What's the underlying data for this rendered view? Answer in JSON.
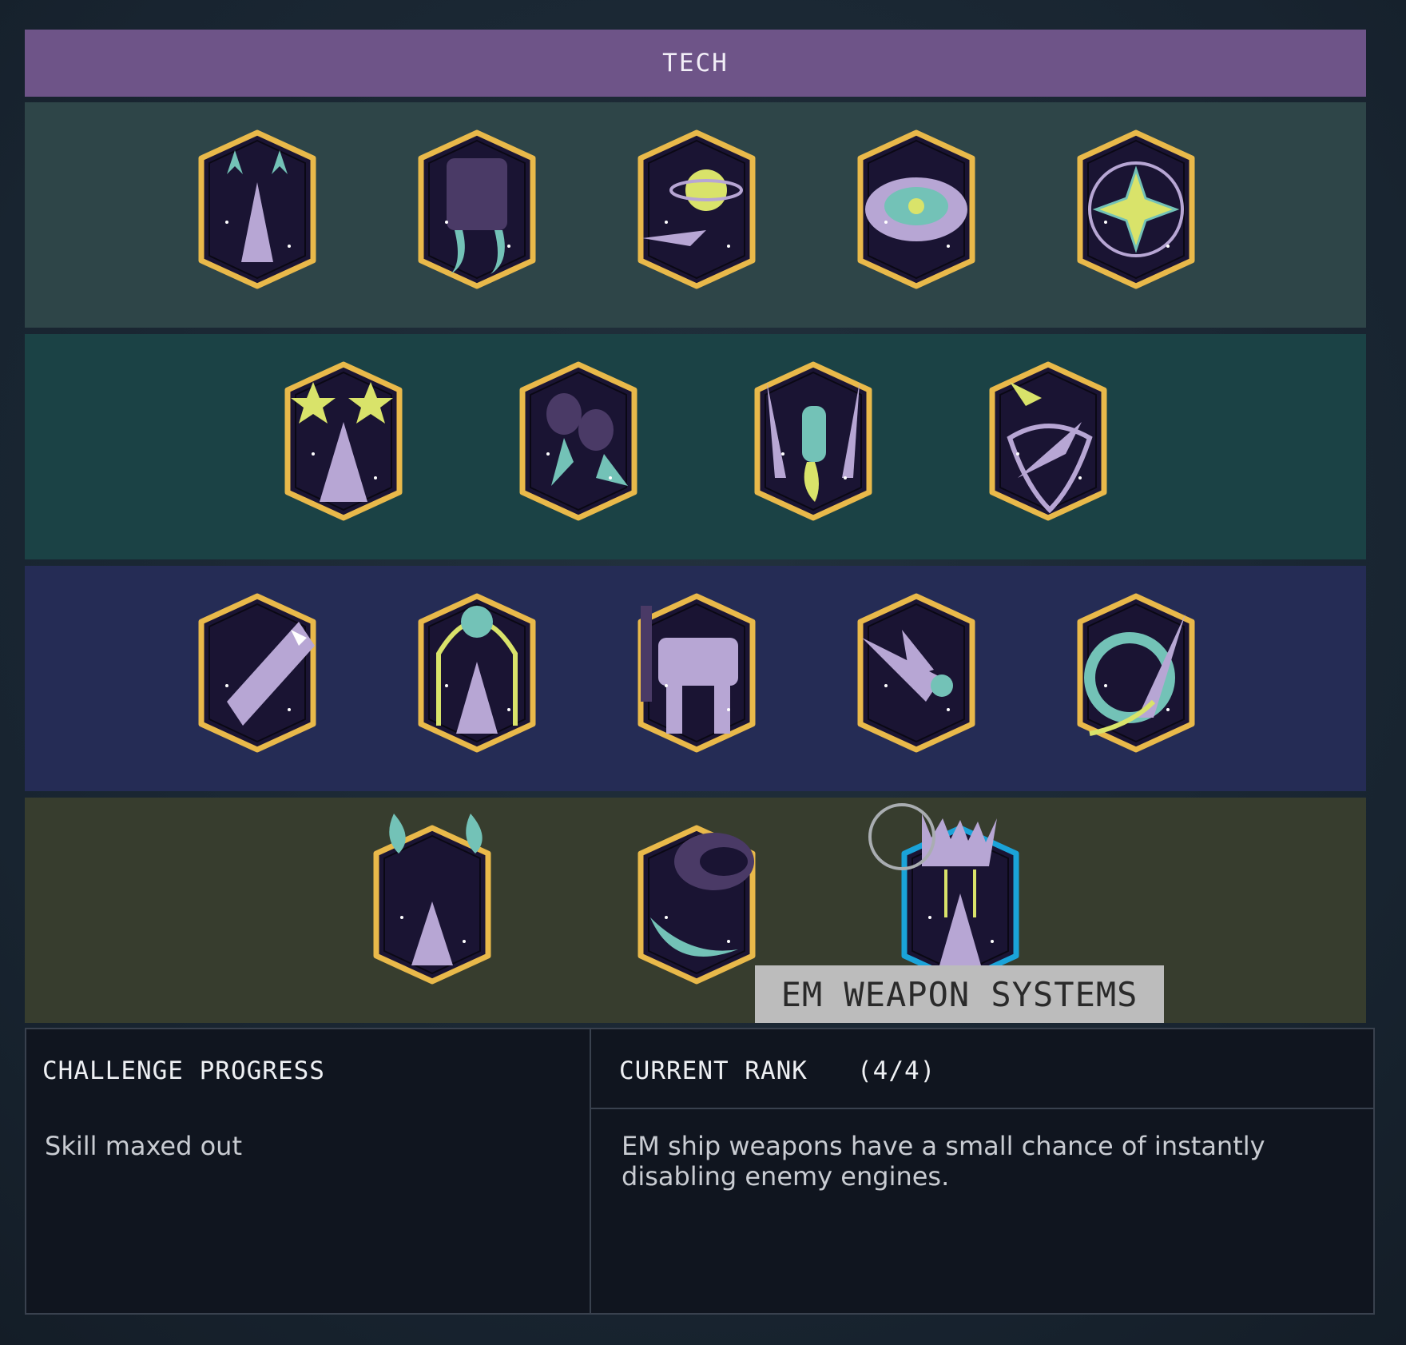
{
  "header": {
    "title": "TECH"
  },
  "rows": [
    {
      "badges": [
        "missile-volley-icon",
        "booster-engine-icon",
        "orbiting-shuttle-icon",
        "targeting-lock-icon",
        "explosion-reticle-icon"
      ]
    },
    {
      "badges": [
        "twin-starburst-ship-icon",
        "thruster-pods-icon",
        "satellite-launch-icon",
        "comet-shield-ship-icon"
      ]
    },
    {
      "badges": [
        "shark-ship-icon",
        "energy-arc-ship-icon",
        "mech-walker-icon",
        "gatling-ship-icon",
        "gear-shuttle-icon"
      ]
    },
    {
      "badges": [
        "flame-jets-ship-icon",
        "astronaut-helmet-icon",
        "em-weapon-ship-icon"
      ]
    }
  ],
  "tooltip": {
    "label": "EM WEAPON SYSTEMS"
  },
  "info": {
    "challenge_title": "CHALLENGE PROGRESS",
    "challenge_text": "Skill maxed out",
    "rank_title": "CURRENT RANK",
    "rank_value": "(4/4)",
    "description": "EM ship weapons have a small chance of instantly disabling enemy engines."
  },
  "colors": {
    "badge_border": "#e9b94a",
    "badge_selected_border": "#1aa3d9",
    "badge_fill": "#1a1433",
    "accent_lavender": "#b7a6d4",
    "accent_lime": "#d9e36a",
    "accent_teal": "#73c2b7"
  }
}
